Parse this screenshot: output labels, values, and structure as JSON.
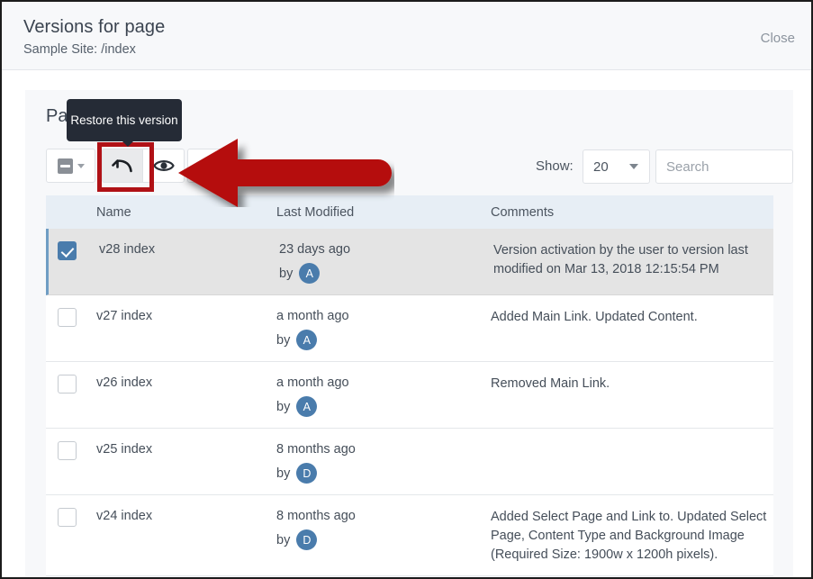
{
  "header": {
    "title": "Versions for page",
    "subtitle": "Sample Site: /index",
    "close_label": "Close"
  },
  "card": {
    "title": "Pas",
    "tooltip": "Restore this version"
  },
  "toolbar": {
    "select_all_icon": "indeterminate-checkbox-icon",
    "select_all_caret": "chevron-down-icon",
    "restore_icon": "undo-arrow-icon",
    "preview_icon": "eye-icon",
    "highlight_color": "#b01116"
  },
  "controls": {
    "show_label": "Show:",
    "show_value": "20",
    "search_placeholder": "Search",
    "search_value": ""
  },
  "table": {
    "columns": [
      "Name",
      "Last Modified",
      "Comments"
    ],
    "rows": [
      {
        "checked": true,
        "selected": true,
        "name": "v28 index",
        "modified": "23 days ago",
        "by_label": "by",
        "avatar": "A",
        "comments": "Version activation by the user            to version last modified on Mar 13, 2018 12:15:54 PM"
      },
      {
        "checked": false,
        "selected": false,
        "name": "v27 index",
        "modified": "a month ago",
        "by_label": "by",
        "avatar": "A",
        "comments": "Added Main Link. Updated Content."
      },
      {
        "checked": false,
        "selected": false,
        "name": "v26 index",
        "modified": "a month ago",
        "by_label": "by",
        "avatar": "A",
        "comments": "Removed Main Link."
      },
      {
        "checked": false,
        "selected": false,
        "name": "v25 index",
        "modified": "8 months ago",
        "by_label": "by",
        "avatar": "D",
        "comments": ""
      },
      {
        "checked": false,
        "selected": false,
        "name": "v24 index",
        "modified": "8 months ago",
        "by_label": "by",
        "avatar": "D",
        "comments": "Added Select Page and Link to. Updated Select Page, Content Type and Background Image (Required Size: 1900w x 1200h pixels)."
      }
    ]
  },
  "annotation": {
    "arrow_icon": "left-pointing-arrow-annotation",
    "arrow_color": "#b50d0d"
  },
  "colors": {
    "accent_blue": "#4a7cac",
    "header_band": "#e7eef5",
    "selected_row": "#e4e4e4",
    "tooltip_bg": "#252b36"
  }
}
